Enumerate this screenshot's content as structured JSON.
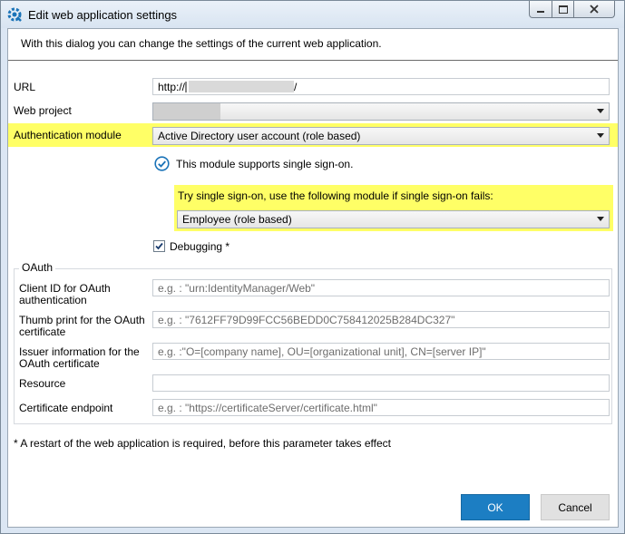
{
  "window": {
    "title": "Edit web application settings"
  },
  "intro": "With this dialog you can change the settings of the current web application.",
  "fields": {
    "url_label": "URL",
    "url_prefix": "http://",
    "url_suffix": "/",
    "web_project_label": "Web project",
    "auth_label": "Authentication module",
    "auth_value": "Active Directory user account (role based)",
    "sso_note": "This module supports single sign-on.",
    "fallback_label": "Try single sign-on, use the following module if single sign-on fails:",
    "fallback_value": "Employee (role based)",
    "debugging_label": "Debugging *",
    "debugging_checked": true
  },
  "oauth": {
    "group_title": "OAuth",
    "client_id_label": "Client ID for OAuth authentication",
    "client_id_placeholder": "e.g. : \"urn:IdentityManager/Web\"",
    "thumb_label": "Thumb print for the OAuth certificate",
    "thumb_placeholder": "e.g. : \"7612FF79D99FCC56BEDD0C758412025B284DC327\"",
    "issuer_label": "Issuer information for the OAuth certificate",
    "issuer_placeholder": "e.g. :\"O=[company name], OU=[organizational unit], CN=[server IP]\"",
    "resource_label": "Resource",
    "resource_value": "",
    "cert_label": "Certificate endpoint",
    "cert_placeholder": "e.g. : \"https://certificateServer/certificate.html\""
  },
  "footnote": "* A restart of the web application is required, before this parameter takes effect",
  "buttons": {
    "ok": "OK",
    "cancel": "Cancel"
  },
  "colors": {
    "highlight": "#ffff66",
    "primary": "#1c7ec3",
    "check_accent": "#1a73b8"
  }
}
